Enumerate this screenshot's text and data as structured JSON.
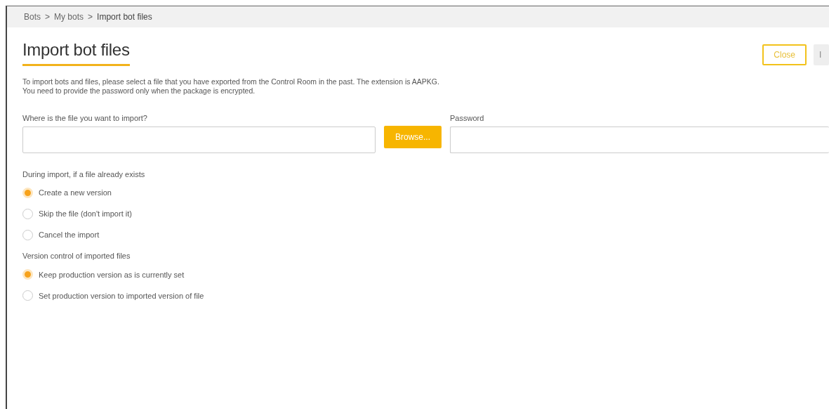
{
  "breadcrumb": [
    {
      "label": "Bots"
    },
    {
      "label": "My bots"
    },
    {
      "label": "Import bot files"
    }
  ],
  "breadcrumb_separator": ">",
  "title": "Import bot files",
  "buttons": [
    {
      "label": "Close",
      "disabled": false
    },
    {
      "label": "I",
      "disabled": true
    }
  ],
  "description": [
    "To import bots and files, please select a file that you have exported from the Control Room in the past. The extension is AAPKG.",
    "You need to provide the password only when the package is encrypted."
  ],
  "file_field": {
    "label": "Where is the file you want to import?"
  },
  "browse_button": "Browse...",
  "password_field": {
    "label": "Password"
  },
  "groups": [
    {
      "label": "During import, if a file already exists",
      "options": [
        {
          "label": "Create a new version",
          "selected": true
        },
        {
          "label": "Skip the file (don't import it)",
          "selected": false
        },
        {
          "label": "Cancel the import",
          "selected": false
        }
      ]
    },
    {
      "label": "Version control of imported files",
      "options": [
        {
          "label": "Keep production version as is currently set",
          "selected": true
        },
        {
          "label": "Set production version to imported version of file",
          "selected": false
        }
      ]
    }
  ]
}
